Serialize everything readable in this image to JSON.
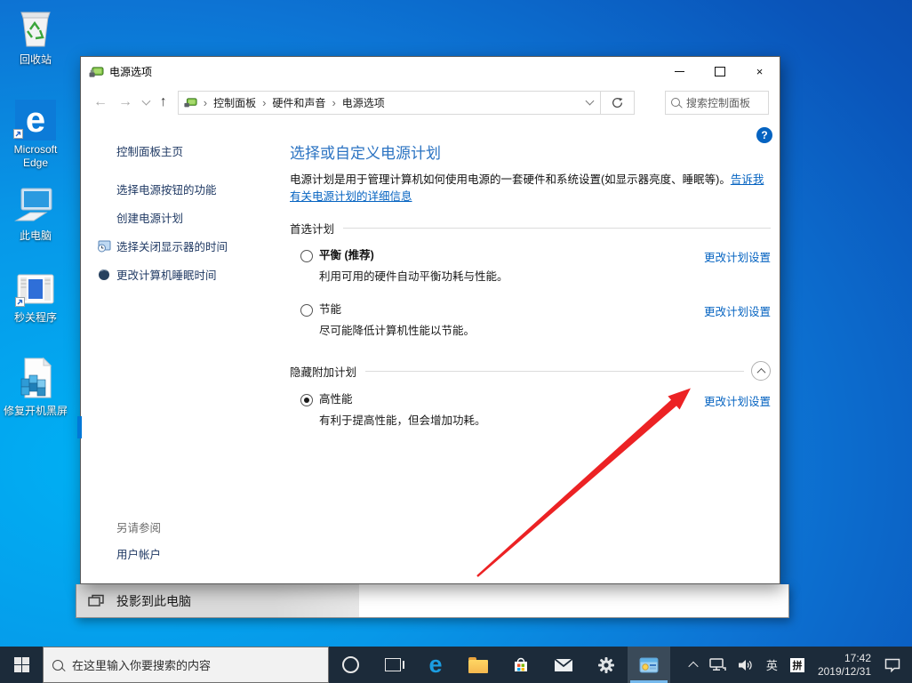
{
  "desktop": {
    "icons": [
      {
        "label": "回收站"
      },
      {
        "label": "Microsoft Edge"
      },
      {
        "label": "此电脑"
      },
      {
        "label": "秒关程序"
      },
      {
        "label": "修复开机黑屏"
      }
    ]
  },
  "powerWindow": {
    "title": "电源选项",
    "breadcrumb": {
      "root": "控制面板",
      "level1": "硬件和声音",
      "level2": "电源选项"
    },
    "searchPlaceholder": "搜索控制面板",
    "sidebar": {
      "home": "控制面板主页",
      "item1": "选择电源按钮的功能",
      "item2": "创建电源计划",
      "item3": "选择关闭显示器的时间",
      "item4": "更改计算机睡眠时间"
    },
    "main": {
      "heading": "选择或自定义电源计划",
      "intro": "电源计划是用于管理计算机如何使用电源的一套硬件和系统设置(如显示器亮度、睡眠等)。",
      "introLink": "告诉我有关电源计划的详细信息",
      "preferredHeader": "首选计划",
      "hiddenHeader": "隐藏附加计划",
      "plans": [
        {
          "label": "平衡 (推荐)",
          "desc": "利用可用的硬件自动平衡功耗与性能。",
          "link": "更改计划设置"
        },
        {
          "label": "节能",
          "desc": "尽可能降低计算机性能以节能。",
          "link": "更改计划设置"
        },
        {
          "label": "高性能",
          "desc": "有利于提高性能，但会增加功耗。",
          "link": "更改计划设置"
        }
      ],
      "seeAlso": "另请参阅",
      "seeAlsoLink": "用户帐户",
      "helpGlyph": "?"
    }
  },
  "backgroundWindow": {
    "item": "投影到此电脑"
  },
  "taskbar": {
    "searchPlaceholder": "在这里输入你要搜索的内容",
    "lang": "英",
    "ime": "拼",
    "time": "17:42",
    "date": "2019/12/31"
  }
}
